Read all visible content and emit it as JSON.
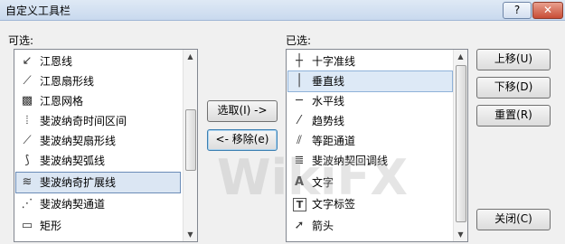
{
  "window": {
    "title": "自定义工具栏",
    "help_label": "?",
    "close_label": "✕"
  },
  "available": {
    "label": "可选:",
    "items": [
      {
        "icon": "↙",
        "label": "江恩线"
      },
      {
        "icon": "⟋",
        "label": "江恩扇形线"
      },
      {
        "icon": "▩",
        "label": "江恩网格"
      },
      {
        "icon": "⦙",
        "label": "斐波纳奇时间区间"
      },
      {
        "icon": "⟋",
        "label": "斐波纳契扇形线"
      },
      {
        "icon": "⟆",
        "label": "斐波纳契弧线"
      },
      {
        "icon": "≋",
        "label": "斐波纳奇扩展线"
      },
      {
        "icon": "⋰",
        "label": "斐波纳契通道"
      },
      {
        "icon": "▭",
        "label": "矩形"
      }
    ]
  },
  "selected": {
    "label": "已选:",
    "items": [
      {
        "icon": "┼",
        "label": "十字准线"
      },
      {
        "icon": "│",
        "label": "垂直线"
      },
      {
        "icon": "─",
        "label": "水平线"
      },
      {
        "icon": "⁄",
        "label": "趋势线"
      },
      {
        "icon": "⫽",
        "label": "等距通道"
      },
      {
        "icon": "≣",
        "label": "斐波纳契回调线"
      },
      {
        "icon": "A",
        "label": "文字"
      },
      {
        "icon": "T",
        "label": "文字标签"
      },
      {
        "icon": "➚",
        "label": "箭头"
      }
    ]
  },
  "buttons": {
    "add": "选取(I) ->",
    "remove": "<- 移除(e)",
    "up": "上移(U)",
    "down": "下移(D)",
    "reset": "重置(R)",
    "close": "关闭(C)"
  }
}
